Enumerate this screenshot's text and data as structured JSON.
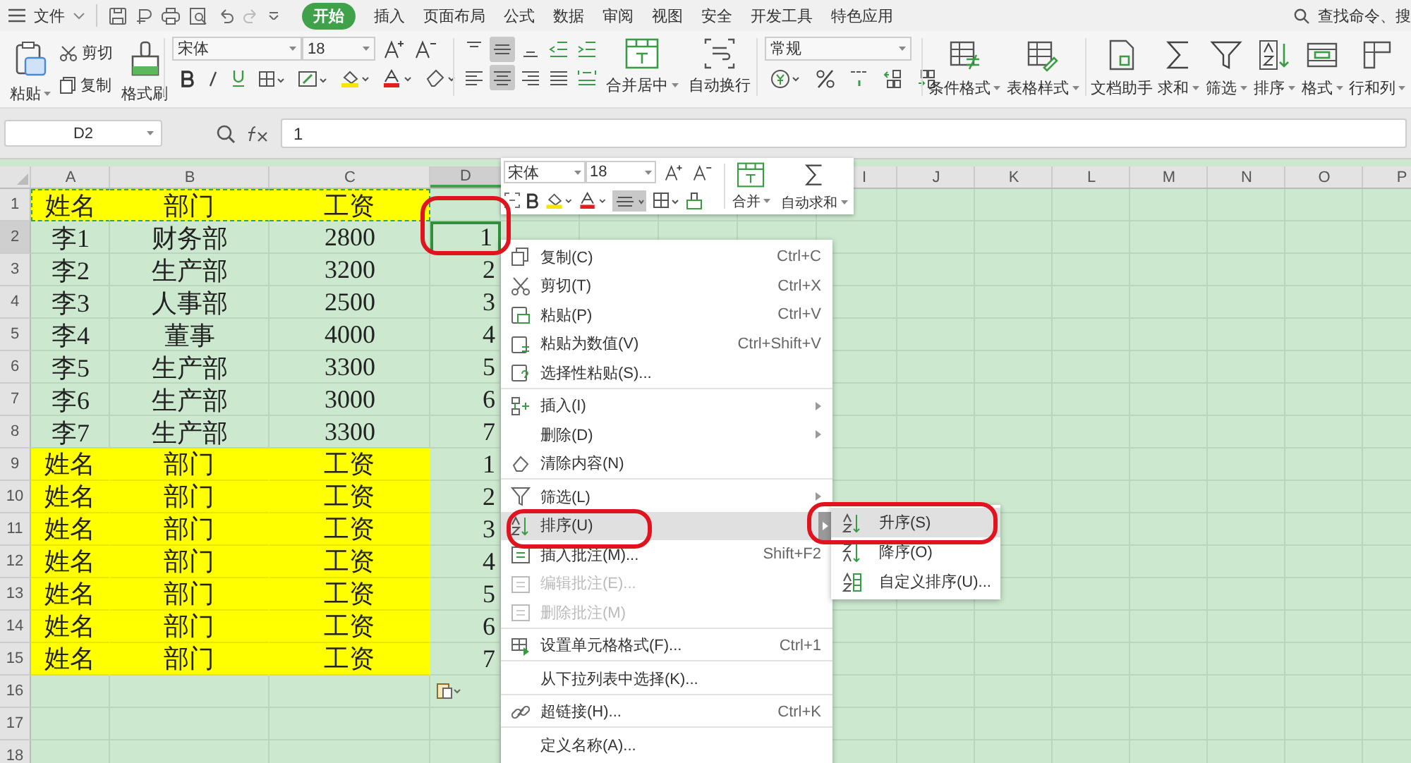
{
  "menu_bar": {
    "file_label": "文件",
    "tabs": [
      {
        "label": "开始",
        "selected": true
      },
      {
        "label": "插入",
        "selected": false
      },
      {
        "label": "页面布局",
        "selected": false
      },
      {
        "label": "公式",
        "selected": false
      },
      {
        "label": "数据",
        "selected": false
      },
      {
        "label": "审阅",
        "selected": false
      },
      {
        "label": "视图",
        "selected": false
      },
      {
        "label": "安全",
        "selected": false
      },
      {
        "label": "开发工具",
        "selected": false
      },
      {
        "label": "特色应用",
        "selected": false
      }
    ],
    "search": "查找命令、搜"
  },
  "ribbon": {
    "paste": "粘贴",
    "cut": "剪切",
    "copy": "复制",
    "format_painter": "格式刷",
    "font": "宋体",
    "size": "18",
    "align_top": [
      {
        "kind": "top",
        "selected": false
      },
      {
        "kind": "middle",
        "selected": true
      },
      {
        "kind": "bottom",
        "selected": false
      },
      {
        "kind": "outdent",
        "selected": false
      },
      {
        "kind": "indent",
        "selected": false
      }
    ],
    "align_bottom": [
      {
        "kind": "left",
        "selected": false
      },
      {
        "kind": "center",
        "selected": true
      },
      {
        "kind": "right",
        "selected": false
      },
      {
        "kind": "justify",
        "selected": false
      },
      {
        "kind": "distribute",
        "selected": false
      }
    ],
    "merge": "合并居中",
    "wrap": "自动换行",
    "number_format": "常规",
    "tools": [
      {
        "label": "条件格式",
        "kind": "conditional",
        "dropdown": true
      },
      {
        "label": "表格样式",
        "kind": "table-style",
        "dropdown": true
      },
      {
        "label": "文档助手",
        "kind": "document",
        "dropdown": false
      },
      {
        "label": "求和",
        "kind": "sum",
        "dropdown": true
      },
      {
        "label": "筛选",
        "kind": "filter",
        "dropdown": true
      },
      {
        "label": "排序",
        "kind": "sort",
        "dropdown": true
      },
      {
        "label": "格式",
        "kind": "format",
        "dropdown": true
      },
      {
        "label": "行和列",
        "kind": "rows-cols",
        "dropdown": true
      }
    ]
  },
  "formula_bar": {
    "cell": "D2",
    "value": "1"
  },
  "sheet": {
    "columns_left": [
      {
        "label": "A",
        "selected": false
      },
      {
        "label": "B",
        "selected": false
      },
      {
        "label": "C",
        "selected": false
      },
      {
        "label": "D",
        "selected": true
      }
    ],
    "columns_right": [
      "I",
      "J",
      "K",
      "L",
      "M",
      "N",
      "O",
      "P"
    ],
    "rows": [
      {
        "number": "1",
        "highlighted": true,
        "selected": false,
        "copy_marquee": true,
        "cells": [
          "姓名",
          "部门",
          "工资"
        ]
      },
      {
        "number": "2",
        "highlighted": false,
        "selected": true,
        "copy_marquee": false,
        "cells": [
          "李1",
          "财务部",
          "2800",
          "1"
        ]
      },
      {
        "number": "3",
        "highlighted": false,
        "selected": false,
        "copy_marquee": false,
        "cells": [
          "李2",
          "生产部",
          "3200",
          "2"
        ]
      },
      {
        "number": "4",
        "highlighted": false,
        "selected": false,
        "copy_marquee": false,
        "cells": [
          "李3",
          "人事部",
          "2500",
          "3"
        ]
      },
      {
        "number": "5",
        "highlighted": false,
        "selected": false,
        "copy_marquee": false,
        "cells": [
          "李4",
          "董事",
          "4000",
          "4"
        ]
      },
      {
        "number": "6",
        "highlighted": false,
        "selected": false,
        "copy_marquee": false,
        "cells": [
          "李5",
          "生产部",
          "3300",
          "5"
        ]
      },
      {
        "number": "7",
        "highlighted": false,
        "selected": false,
        "copy_marquee": false,
        "cells": [
          "李6",
          "生产部",
          "3000",
          "6"
        ]
      },
      {
        "number": "8",
        "highlighted": false,
        "selected": false,
        "copy_marquee": false,
        "cells": [
          "李7",
          "生产部",
          "3300",
          "7"
        ]
      },
      {
        "number": "9",
        "highlighted": true,
        "selected": false,
        "copy_marquee": false,
        "cells": [
          "姓名",
          "部门",
          "工资",
          "1"
        ]
      },
      {
        "number": "10",
        "highlighted": true,
        "selected": false,
        "copy_marquee": false,
        "cells": [
          "姓名",
          "部门",
          "工资",
          "2"
        ]
      },
      {
        "number": "11",
        "highlighted": true,
        "selected": false,
        "copy_marquee": false,
        "cells": [
          "姓名",
          "部门",
          "工资",
          "3"
        ]
      },
      {
        "number": "12",
        "highlighted": true,
        "selected": false,
        "copy_marquee": false,
        "cells": [
          "姓名",
          "部门",
          "工资",
          "4"
        ]
      },
      {
        "number": "13",
        "highlighted": true,
        "selected": false,
        "copy_marquee": false,
        "cells": [
          "姓名",
          "部门",
          "工资",
          "5"
        ]
      },
      {
        "number": "14",
        "highlighted": true,
        "selected": false,
        "copy_marquee": false,
        "cells": [
          "姓名",
          "部门",
          "工资",
          "6"
        ]
      },
      {
        "number": "15",
        "highlighted": true,
        "selected": false,
        "copy_marquee": false,
        "cells": [
          "姓名",
          "部门",
          "工资",
          "7"
        ]
      },
      {
        "number": "16",
        "highlighted": false,
        "selected": false,
        "copy_marquee": false,
        "paste_options": true
      },
      {
        "number": "17",
        "highlighted": false,
        "selected": false,
        "copy_marquee": false
      },
      {
        "number": "18",
        "highlighted": false,
        "selected": false,
        "copy_marquee": false
      }
    ]
  },
  "mini_toolbar": {
    "font": "宋体",
    "size": "18",
    "merge": "合并",
    "autosum": "自动求和",
    "align_selected": true
  },
  "context_menu": {
    "items": [
      {
        "label": "复制(C)",
        "kind": "copy",
        "shortcut": "Ctrl+C",
        "submenu": false,
        "disabled": false,
        "selected": false,
        "separator_after": false
      },
      {
        "label": "剪切(T)",
        "kind": "cut",
        "shortcut": "Ctrl+X",
        "submenu": false,
        "disabled": false,
        "selected": false,
        "separator_after": false
      },
      {
        "label": "粘贴(P)",
        "kind": "paste",
        "shortcut": "Ctrl+V",
        "submenu": false,
        "disabled": false,
        "selected": false,
        "separator_after": false
      },
      {
        "label": "粘贴为数值(V)",
        "kind": "paste-values",
        "shortcut": "Ctrl+Shift+V",
        "submenu": false,
        "disabled": false,
        "selected": false,
        "separator_after": false
      },
      {
        "label": "选择性粘贴(S)...",
        "kind": "paste-special",
        "submenu": false,
        "disabled": false,
        "selected": false,
        "separator_after": true
      },
      {
        "label": "插入(I)",
        "kind": "insert",
        "submenu": true,
        "disabled": false,
        "selected": false,
        "separator_after": false
      },
      {
        "label": "删除(D)",
        "kind": "plain",
        "submenu": true,
        "disabled": false,
        "selected": false,
        "separator_after": false
      },
      {
        "label": "清除内容(N)",
        "kind": "eraser",
        "submenu": false,
        "disabled": false,
        "selected": false,
        "separator_after": true
      },
      {
        "label": "筛选(L)",
        "kind": "filter",
        "submenu": true,
        "disabled": false,
        "selected": false,
        "separator_after": false
      },
      {
        "label": "排序(U)",
        "kind": "sort",
        "submenu": true,
        "disabled": false,
        "selected": true,
        "separator_after": false
      },
      {
        "label": "插入批注(M)...",
        "kind": "comment",
        "shortcut": "Shift+F2",
        "submenu": false,
        "disabled": false,
        "selected": false,
        "separator_after": false
      },
      {
        "label": "编辑批注(E)...",
        "kind": "comment",
        "submenu": false,
        "disabled": true,
        "selected": false,
        "separator_after": false
      },
      {
        "label": "删除批注(M)",
        "kind": "comment",
        "submenu": false,
        "disabled": true,
        "selected": false,
        "separator_after": true
      },
      {
        "label": "设置单元格格式(F)...",
        "kind": "format-cells",
        "shortcut": "Ctrl+1",
        "submenu": false,
        "disabled": false,
        "selected": false,
        "separator_after": true
      },
      {
        "label": "从下拉列表中选择(K)...",
        "kind": "plain",
        "submenu": false,
        "disabled": false,
        "selected": false,
        "separator_after": true
      },
      {
        "label": "超链接(H)...",
        "kind": "link",
        "shortcut": "Ctrl+K",
        "submenu": false,
        "disabled": false,
        "selected": false,
        "separator_after": true
      },
      {
        "label": "定义名称(A)...",
        "kind": "plain",
        "submenu": false,
        "disabled": false,
        "selected": false,
        "separator_after": false
      }
    ]
  },
  "submenu": {
    "items": [
      {
        "label": "升序(S)",
        "kind": "sort-asc",
        "selected": true
      },
      {
        "label": "降序(O)",
        "kind": "sort-desc",
        "selected": false
      },
      {
        "label": "自定义排序(U)...",
        "kind": "sort-custom",
        "selected": false
      }
    ]
  }
}
